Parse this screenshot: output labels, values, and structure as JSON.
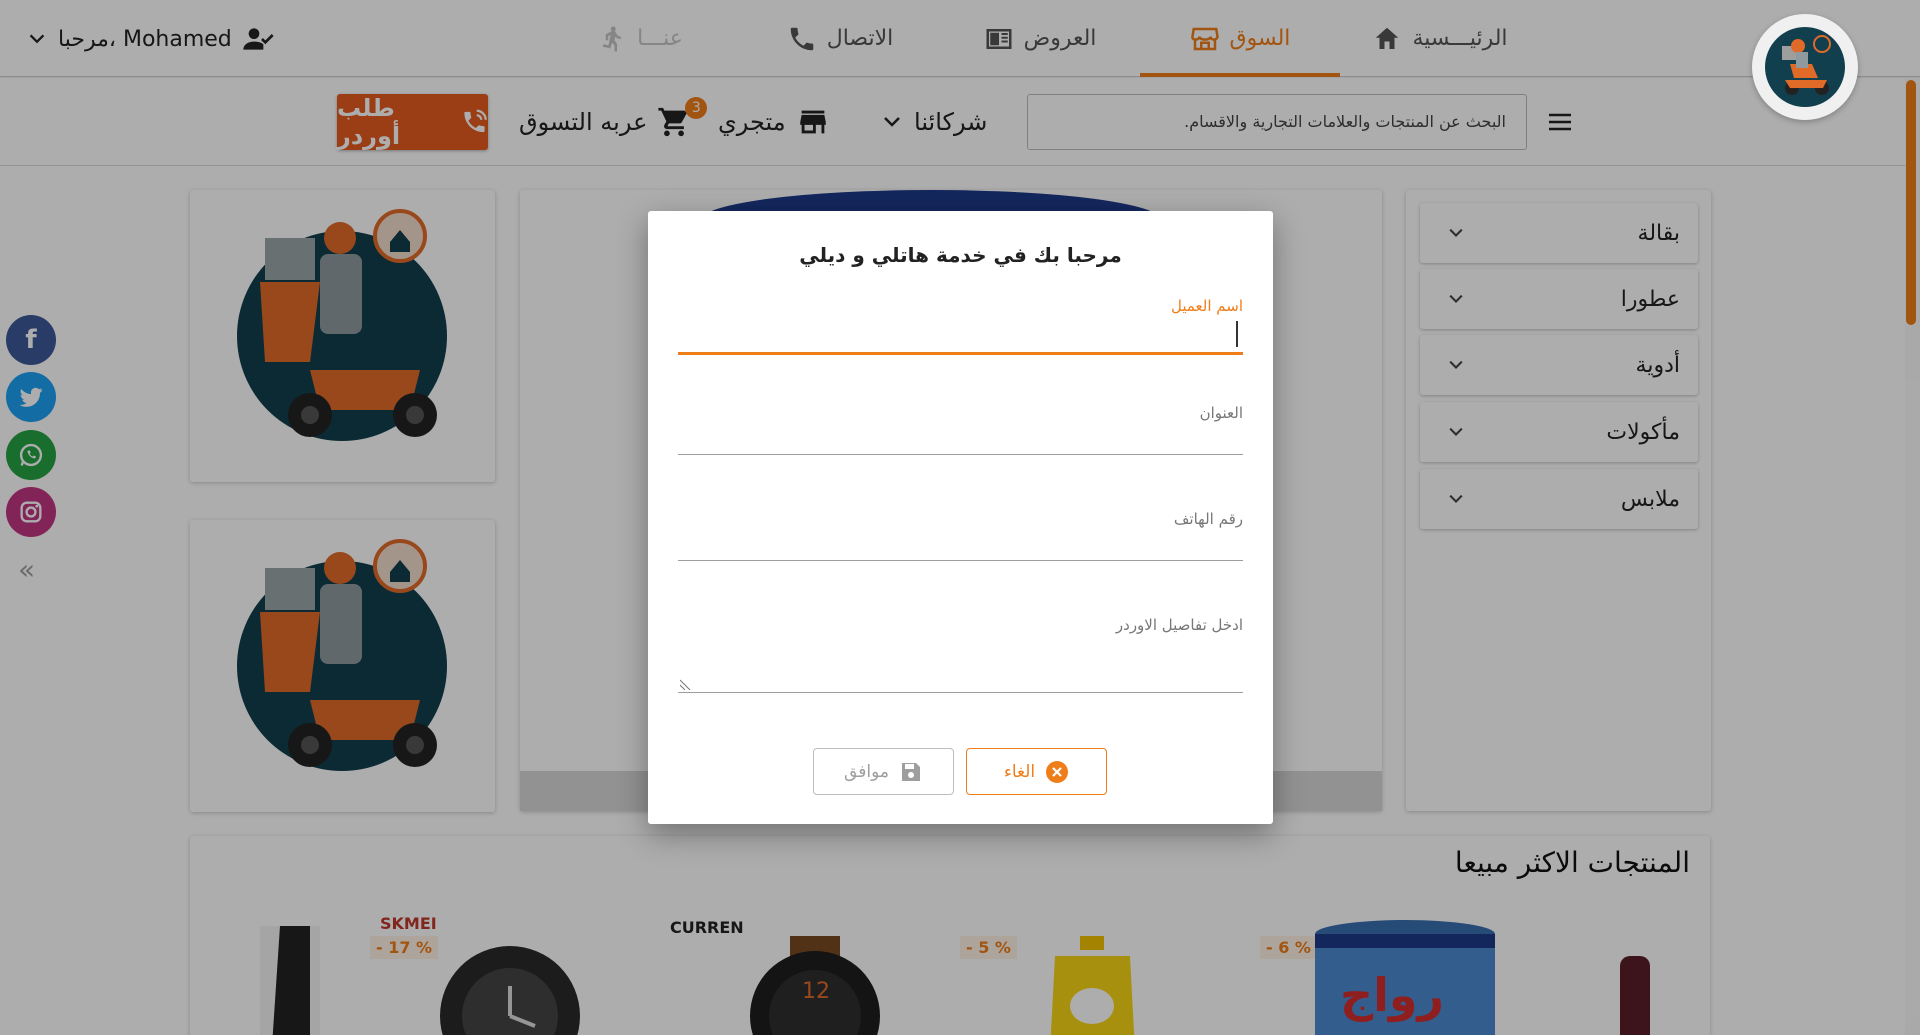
{
  "user": {
    "greeting": "مرحبا، Mohamed"
  },
  "nav": {
    "items": [
      {
        "label": "الرئيـــسية",
        "icon": "home-icon"
      },
      {
        "label": "السوق",
        "icon": "store-icon"
      },
      {
        "label": "العروض",
        "icon": "newspaper-icon"
      },
      {
        "label": "الاتصال",
        "icon": "phone-icon"
      },
      {
        "label": "عنـــا",
        "icon": "walking-icon"
      }
    ],
    "active_index": 1
  },
  "toolbar": {
    "order_button": "طلب أوردر",
    "cart_label": "عربه التسوق",
    "cart_count": "3",
    "my_store_label": "متجري",
    "partners_label": "شركائنا",
    "search_placeholder": "البحث عن المنتجات والعلامات التجارية والاقسام."
  },
  "categories": [
    "بقالة",
    "عطورا",
    "أدوية",
    "مأكولات",
    "ملابس"
  ],
  "social": [
    "facebook-icon",
    "twitter-icon",
    "whatsapp-icon",
    "instagram-icon"
  ],
  "best_sellers": {
    "title": "المنتجات الاكثر مبيعا",
    "products": [
      {
        "brand": "",
        "discount": ""
      },
      {
        "brand": "SKMEI",
        "discount": "- 17 %"
      },
      {
        "brand": "CURREN",
        "discount": ""
      },
      {
        "brand": "",
        "discount": "- 5 %"
      },
      {
        "brand": "رواج",
        "discount": "- 6 %"
      }
    ]
  },
  "dialog": {
    "title": "مرحبا بك في خدمة هاتلي و ديلي",
    "fields": {
      "customer_name": "اسم العميل",
      "address": "العنوان",
      "phone": "رقم الهاتف",
      "order_details": "ادخل تفاصيل الاوردر"
    },
    "cancel_label": "الغاء",
    "ok_label": "موافق"
  },
  "colors": {
    "accent": "#ef7d1a",
    "order_button": "#e55b1f",
    "facebook": "#3b5998",
    "twitter": "#1da1f2",
    "whatsapp": "#25a244",
    "instagram": "#c13584"
  }
}
